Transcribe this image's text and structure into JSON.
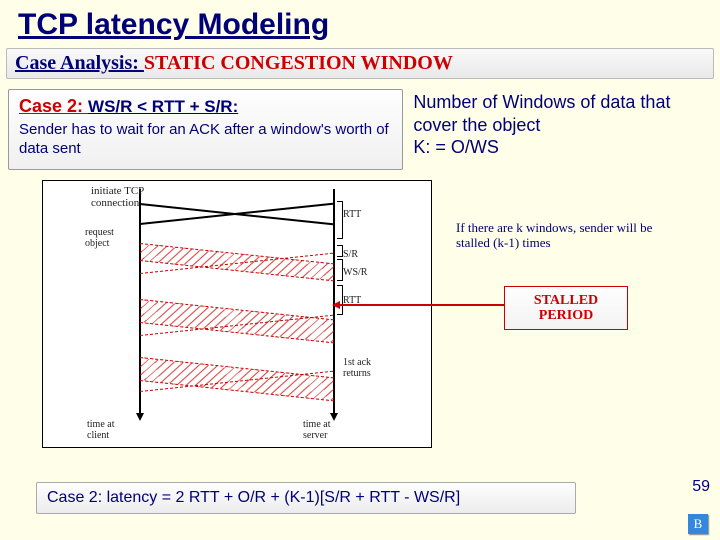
{
  "title": "TCP latency Modeling",
  "subtitle": {
    "lead": "Case Analysis: ",
    "rest": "STATIC CONGESTION WINDOW"
  },
  "caseBox": {
    "label": "Case 2: ",
    "condition": "WS/R < RTT + S/R:",
    "desc": "Sender has to wait for an ACK after a window's worth of data sent"
  },
  "numWindows": "Number of Windows of data that cover the object\nK: = O/WS",
  "diagram": {
    "top_left": "initiate TCP\nconnection",
    "top_right": "",
    "request": "request\nobject",
    "rtt": "RTT",
    "sr": "S/R",
    "wsr": "WS/R",
    "rtt2": "RTT",
    "ack": "1st ack\nreturns",
    "time_client": "time at\nclient",
    "time_server": "time at\nserver"
  },
  "sideNote": "If there are k windows, sender will be stalled (k-1) times",
  "stalled": "STALLED PERIOD",
  "formula": "Case 2: latency = 2 RTT + O/R + (K-1)[S/R + RTT - WS/R]",
  "pageNumber": "59",
  "badge": "B"
}
